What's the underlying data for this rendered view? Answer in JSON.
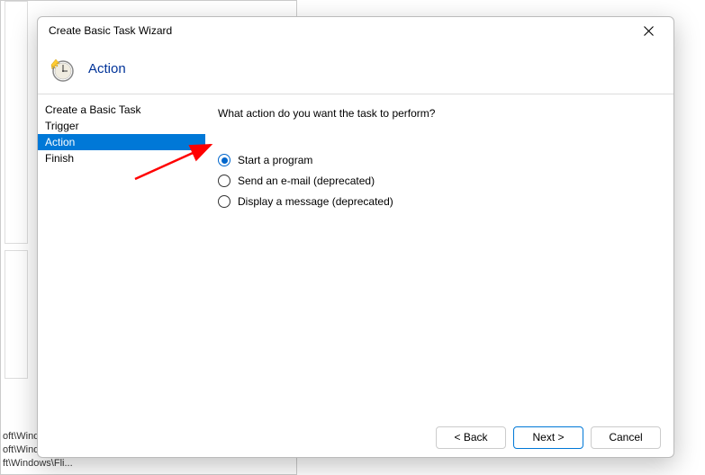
{
  "background": {
    "line1": "oft\\Windc",
    "line2": "oft\\Windows\\U...",
    "line3": "ft\\Windows\\Fli..."
  },
  "dialog": {
    "title": "Create Basic Task Wizard",
    "header_title": "Action",
    "close_label": "Close"
  },
  "sidebar": {
    "items": [
      {
        "label": "Create a Basic Task",
        "selected": false
      },
      {
        "label": "Trigger",
        "selected": false
      },
      {
        "label": "Action",
        "selected": true
      },
      {
        "label": "Finish",
        "selected": false
      }
    ]
  },
  "main": {
    "prompt": "What action do you want the task to perform?",
    "options": [
      {
        "label": "Start a program",
        "checked": true
      },
      {
        "label": "Send an e-mail (deprecated)",
        "checked": false
      },
      {
        "label": "Display a message (deprecated)",
        "checked": false
      }
    ]
  },
  "footer": {
    "back": "< Back",
    "next": "Next >",
    "cancel": "Cancel"
  }
}
